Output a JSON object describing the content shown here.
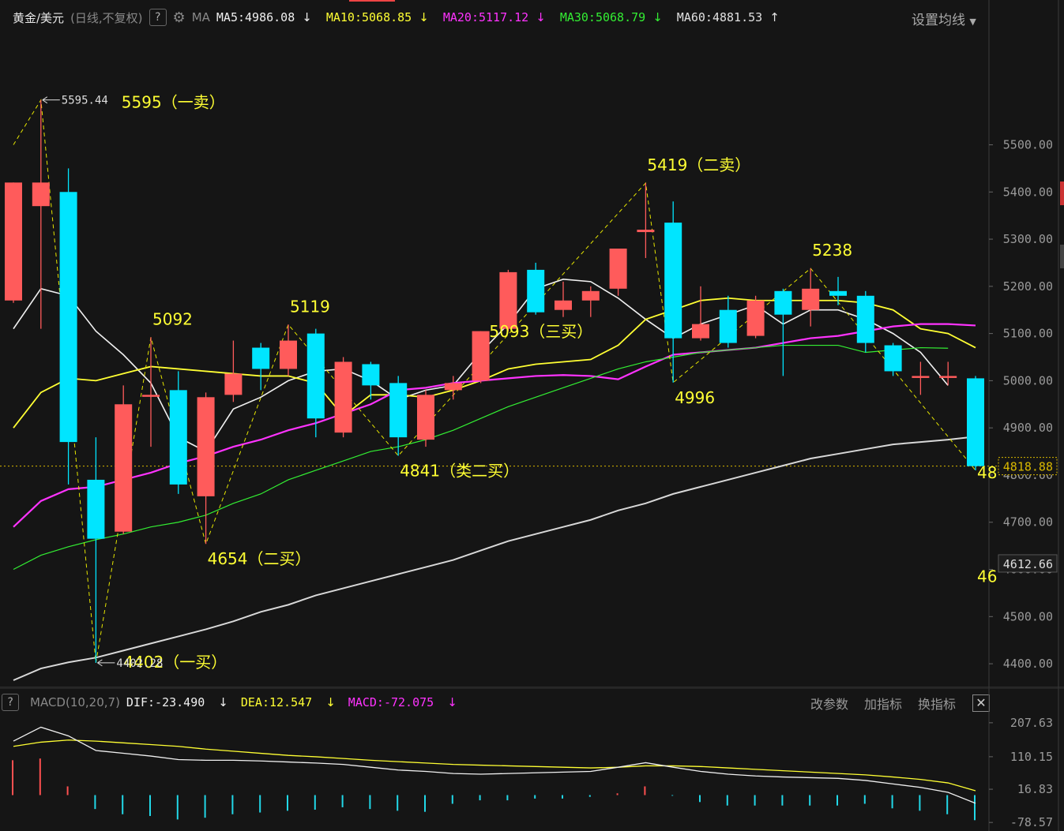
{
  "header": {
    "symbol": "黄金/美元",
    "period": "(日线,不复权)",
    "help": "?",
    "ma_label": "MA",
    "ma": [
      {
        "text": "MA5:4986.08",
        "arrow": "↓",
        "color": "#f0f0f0"
      },
      {
        "text": "MA10:5068.85",
        "arrow": "↓",
        "color": "#ffff33"
      },
      {
        "text": "MA20:5117.12",
        "arrow": "↓",
        "color": "#ff33ff"
      },
      {
        "text": "MA30:5068.79",
        "arrow": "↓",
        "color": "#33ee33"
      },
      {
        "text": "MA60:4881.53",
        "arrow": "↑",
        "color": "#e0e0e0"
      }
    ],
    "settings": "设置均线"
  },
  "macd_header": {
    "help": "?",
    "name": "MACD(10,20,7)",
    "dif": {
      "text": "DIF:-23.490",
      "arrow": "↓",
      "color": "#f0f0f0"
    },
    "dea": {
      "text": "DEA:12.547",
      "arrow": "↓",
      "color": "#ffff33"
    },
    "macd": {
      "text": "MACD:-72.075",
      "arrow": "↓",
      "color": "#ff33ff"
    },
    "buttons": [
      "改参数",
      "加指标",
      "换指标"
    ],
    "close": "✕"
  },
  "colors": {
    "up": "#ff5b5b",
    "down": "#00e5ff",
    "ma5": "#f0f0f0",
    "ma10": "#ffff33",
    "ma20": "#ff33ff",
    "ma30": "#33ee33",
    "ma60": "#d8d8d8",
    "annotation": "#ffff33"
  },
  "chart_data": {
    "type": "candlestick",
    "ylim": [
      4360,
      5740
    ],
    "price_ticks": [
      "5500.00",
      "5400.00",
      "5300.00",
      "5200.00",
      "5100.00",
      "5000.00",
      "4900.00",
      "4800.00",
      "4700.00",
      "4600.00",
      "4500.00",
      "4400.00"
    ],
    "current_price": "4818.88",
    "marker_price": "4612.66",
    "candles": [
      {
        "o": 5170,
        "h": 5420,
        "l": 5165,
        "c": 5420
      },
      {
        "o": 5370,
        "h": 5595,
        "l": 5110,
        "c": 5420
      },
      {
        "o": 5400,
        "h": 5450,
        "l": 4780,
        "c": 4870
      },
      {
        "o": 4790,
        "h": 4880,
        "l": 4402,
        "c": 4665
      },
      {
        "o": 4680,
        "h": 4990,
        "l": 4675,
        "c": 4950
      },
      {
        "o": 4970,
        "h": 5092,
        "l": 4860,
        "c": 4970
      },
      {
        "o": 4980,
        "h": 5020,
        "l": 4760,
        "c": 4780
      },
      {
        "o": 4755,
        "h": 4975,
        "l": 4654,
        "c": 4965
      },
      {
        "o": 4970,
        "h": 5085,
        "l": 4955,
        "c": 5015
      },
      {
        "o": 5070,
        "h": 5080,
        "l": 4980,
        "c": 5025
      },
      {
        "o": 5025,
        "h": 5119,
        "l": 5010,
        "c": 5085
      },
      {
        "o": 5100,
        "h": 5110,
        "l": 4880,
        "c": 4920
      },
      {
        "o": 4890,
        "h": 5050,
        "l": 4880,
        "c": 5040
      },
      {
        "o": 5035,
        "h": 5040,
        "l": 4960,
        "c": 4990
      },
      {
        "o": 4995,
        "h": 5010,
        "l": 4841,
        "c": 4880
      },
      {
        "o": 4875,
        "h": 4980,
        "l": 4860,
        "c": 4970
      },
      {
        "o": 4980,
        "h": 5010,
        "l": 4960,
        "c": 4995
      },
      {
        "o": 5000,
        "h": 5105,
        "l": 4995,
        "c": 5105
      },
      {
        "o": 5110,
        "h": 5235,
        "l": 5105,
        "c": 5230
      },
      {
        "o": 5235,
        "h": 5250,
        "l": 5140,
        "c": 5145
      },
      {
        "o": 5150,
        "h": 5210,
        "l": 5135,
        "c": 5170
      },
      {
        "o": 5170,
        "h": 5200,
        "l": 5135,
        "c": 5190
      },
      {
        "o": 5195,
        "h": 5280,
        "l": 5180,
        "c": 5280
      },
      {
        "o": 5315,
        "h": 5419,
        "l": 5260,
        "c": 5320
      },
      {
        "o": 5335,
        "h": 5380,
        "l": 4996,
        "c": 5090
      },
      {
        "o": 5090,
        "h": 5200,
        "l": 5085,
        "c": 5120
      },
      {
        "o": 5150,
        "h": 5180,
        "l": 5070,
        "c": 5080
      },
      {
        "o": 5095,
        "h": 5180,
        "l": 5090,
        "c": 5170
      },
      {
        "o": 5190,
        "h": 5195,
        "l": 5010,
        "c": 5140
      },
      {
        "o": 5150,
        "h": 5238,
        "l": 5115,
        "c": 5195
      },
      {
        "o": 5190,
        "h": 5220,
        "l": 5160,
        "c": 5180
      },
      {
        "o": 5180,
        "h": 5190,
        "l": 5060,
        "c": 5080
      },
      {
        "o": 5075,
        "h": 5080,
        "l": 5010,
        "c": 5020
      },
      {
        "o": 5010,
        "h": 5040,
        "l": 4970,
        "c": 5010
      },
      {
        "o": 5010,
        "h": 5040,
        "l": 4990,
        "c": 5010
      },
      {
        "o": 5005,
        "h": 5010,
        "l": 4810,
        "c": 4818.88
      }
    ],
    "ma_series": [
      {
        "name": "MA5",
        "values": [
          5110,
          5195,
          5180,
          5105,
          5055,
          4995,
          4880,
          4850,
          4940,
          4965,
          5000,
          5020,
          5025,
          5000,
          4960,
          4980,
          4990,
          5060,
          5120,
          5195,
          5215,
          5210,
          5175,
          5130,
          5090,
          5120,
          5140,
          5160,
          5120,
          5150,
          5150,
          5130,
          5100,
          5060,
          4990
        ]
      },
      {
        "name": "MA10",
        "values": [
          4900,
          4975,
          5005,
          5000,
          5015,
          5030,
          5025,
          5020,
          5015,
          5010,
          5010,
          4995,
          4925,
          4970,
          4970,
          4965,
          4980,
          5000,
          5025,
          5035,
          5040,
          5045,
          5075,
          5130,
          5150,
          5170,
          5175,
          5170,
          5170,
          5170,
          5170,
          5165,
          5150,
          5110,
          5100,
          5070
        ]
      },
      {
        "name": "MA20",
        "values": [
          4690,
          4745,
          4770,
          4775,
          4790,
          4805,
          4825,
          4840,
          4860,
          4875,
          4895,
          4910,
          4930,
          4950,
          4980,
          4985,
          4995,
          5000,
          5005,
          5010,
          5012,
          5010,
          5003,
          5030,
          5055,
          5060,
          5065,
          5070,
          5080,
          5090,
          5095,
          5105,
          5115,
          5120,
          5120,
          5117
        ]
      },
      {
        "name": "MA30",
        "values": [
          4600,
          4630,
          4648,
          4663,
          4675,
          4690,
          4700,
          4715,
          4740,
          4760,
          4790,
          4810,
          4830,
          4850,
          4860,
          4875,
          4895,
          4920,
          4945,
          4965,
          4985,
          5005,
          5025,
          5040,
          5050,
          5060,
          5065,
          5070,
          5075,
          5075,
          5075,
          5060,
          5065,
          5070,
          5068.79
        ]
      },
      {
        "name": "MA60",
        "values": [
          4365,
          4390,
          4403,
          4413,
          4428,
          4443,
          4458,
          4473,
          4490,
          4510,
          4525,
          4545,
          4560,
          4575,
          4590,
          4605,
          4620,
          4640,
          4660,
          4675,
          4690,
          4705,
          4725,
          4740,
          4760,
          4775,
          4790,
          4805,
          4820,
          4835,
          4845,
          4855,
          4865,
          4870,
          4875,
          4881.53
        ]
      }
    ],
    "zigzag": [
      [
        0,
        5500
      ],
      [
        1,
        5595
      ],
      [
        3,
        4402
      ],
      [
        5,
        5092
      ],
      [
        7,
        4654
      ],
      [
        10,
        5119
      ],
      [
        14,
        4841
      ],
      [
        23,
        5419
      ],
      [
        24,
        4996
      ],
      [
        29,
        5238
      ],
      [
        35,
        4810
      ]
    ],
    "annotations": [
      {
        "i": 1,
        "price": 5595,
        "text": "5595（一卖）",
        "pos": "right-above"
      },
      {
        "i": 1,
        "price": 5595,
        "text": "5595.44",
        "pos": "max"
      },
      {
        "i": 3,
        "price": 4402,
        "text": "4402（一买）",
        "pos": "right"
      },
      {
        "i": 3,
        "price": 4402,
        "text": "4402.28",
        "pos": "min"
      },
      {
        "i": 5,
        "price": 5092,
        "text": "5092",
        "pos": "above"
      },
      {
        "i": 7,
        "price": 4654,
        "text": "4654（二买）",
        "pos": "below"
      },
      {
        "i": 10,
        "price": 5119,
        "text": "5119",
        "pos": "above"
      },
      {
        "i": 14,
        "price": 4841,
        "text": "4841（类二买）",
        "pos": "below"
      },
      {
        "i": 18,
        "price": 5105,
        "text": "5093（三买）",
        "pos": "below"
      },
      {
        "i": 23,
        "price": 5419,
        "text": "5419（二卖）",
        "pos": "above"
      },
      {
        "i": 24,
        "price": 4996,
        "text": "4996",
        "pos": "below"
      },
      {
        "i": 29,
        "price": 5238,
        "text": "5238",
        "pos": "above"
      },
      {
        "i": 35,
        "price": 4810,
        "text": "48",
        "pos": "clip"
      },
      {
        "i": 35,
        "price": 4590,
        "text": "46",
        "pos": "clip"
      }
    ],
    "macd": {
      "ylim": [
        -85,
        230
      ],
      "ticks": [
        "207.63",
        "110.15",
        "16.83",
        "-78.57"
      ],
      "dif": [
        155,
        195,
        170,
        128,
        120,
        112,
        102,
        100,
        100,
        98,
        95,
        92,
        88,
        80,
        72,
        68,
        62,
        60,
        62,
        64,
        66,
        68,
        80,
        93,
        80,
        68,
        60,
        55,
        52,
        50,
        48,
        42,
        32,
        22,
        8,
        -23.49
      ],
      "dea": [
        140,
        152,
        158,
        155,
        150,
        145,
        140,
        132,
        126,
        120,
        114,
        110,
        105,
        100,
        96,
        92,
        88,
        86,
        84,
        82,
        80,
        78,
        80,
        84,
        84,
        82,
        78,
        74,
        70,
        66,
        62,
        58,
        52,
        45,
        35,
        12.547
      ],
      "hist": [
        100,
        105,
        25,
        -40,
        -55,
        -60,
        -70,
        -65,
        -55,
        -50,
        -45,
        -42,
        -35,
        -40,
        -45,
        -48,
        -25,
        -15,
        -15,
        -10,
        -10,
        -5,
        5,
        25,
        -2,
        -20,
        -30,
        -30,
        -30,
        -30,
        -30,
        -25,
        -38,
        -45,
        -55,
        -72.075
      ]
    }
  }
}
